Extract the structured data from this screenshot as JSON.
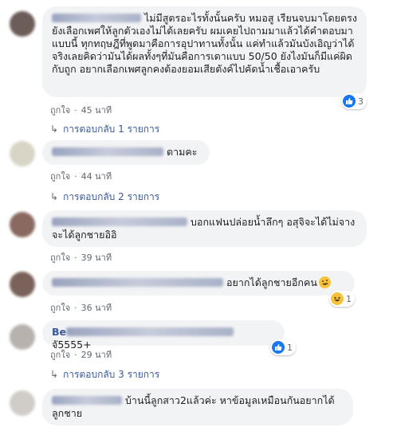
{
  "comments": [
    {
      "text": "ไม่มีสูตรอะไรทั้งนั้นครับ หมอสู เรียนจบมาโดยตรงยังเลือกเพศให้ลูกตัวเองไม่ได้เลยครับ ผมเคยไปถามมาแล้วได้คำตอบมาแบบนี้ ทุกทฤษฎีที่พูดมาคือการอุปาทานทั้งนั้น แค่ทำแล้วมันบังเอิญว่าได้จริงเลยคิดว่ามันได้ผลทั้งๆที่มันคือการเดาแบบ 50/50 ยังไงมันก็มีแค่ผิดกับถูก อยากเลือกเพศลูกคงต้องยอมเสียตังค์ไปคัดน้ำเชื้อเอาครับ",
      "like_label": "ถูกใจ",
      "time": "45 นาที",
      "reaction_count": "3",
      "reply_label": "การตอบกลับ 1 รายการ"
    },
    {
      "text": "ตามคะ",
      "like_label": "ถูกใจ",
      "time": "44 นาที",
      "reply_label": "การตอบกลับ 2 รายการ"
    },
    {
      "text": "บอกแฟนปล่อยน้ำลึกๆ อสุจิจะได้ไม่จางจะได้ลูกชายอิอิ",
      "like_label": "ถูกใจ",
      "time": "39 นาที"
    },
    {
      "text": "อยากได้ลูกชายอีกคน",
      "like_label": "ถูกใจ",
      "time": "36 นาที",
      "reaction_count": "1"
    },
    {
      "name_prefix": "Be",
      "text": "จั5555+",
      "like_label": "ถูกใจ",
      "time": "29 นาที",
      "reaction_count": "1",
      "reply_label": "การตอบกลับ 3 รายการ"
    },
    {
      "text": "บ้านนี้ลูกสาว2แล้วค่ะ หาข้อมูลเหมือนกันอยากได้ลูกชาย"
    }
  ],
  "colors": {
    "link": "#385898",
    "bubble": "#f2f3f5",
    "like_blue": "#1877f2",
    "haha_yellow": "#f7c33c"
  }
}
